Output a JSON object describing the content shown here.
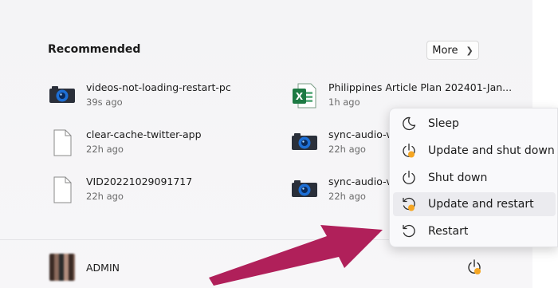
{
  "recommended": {
    "title": "Recommended",
    "more_label": "More",
    "items": [
      {
        "name": "videos-not-loading-restart-pc",
        "time": "39s ago",
        "icon": "camera-icon"
      },
      {
        "name": "clear-cache-twitter-app",
        "time": "22h ago",
        "icon": "document-icon"
      },
      {
        "name": "VID20221029091717",
        "time": "22h ago",
        "icon": "document-icon"
      },
      {
        "name": "Philippines Article Plan 202401-Jan...",
        "time": "1h ago",
        "icon": "excel-icon"
      },
      {
        "name": "sync-audio-vi",
        "time": "22h ago",
        "icon": "camera-icon"
      },
      {
        "name": "sync-audio-vi",
        "time": "22h ago",
        "icon": "camera-icon"
      }
    ]
  },
  "user": {
    "name": "ADMIN"
  },
  "power_menu": {
    "items": [
      {
        "label": "Sleep",
        "icon": "moon-icon"
      },
      {
        "label": "Update and shut down",
        "icon": "update-power-icon"
      },
      {
        "label": "Shut down",
        "icon": "power-icon"
      },
      {
        "label": "Update and restart",
        "icon": "update-restart-icon"
      },
      {
        "label": "Restart",
        "icon": "restart-icon"
      }
    ],
    "highlighted": "Update and restart"
  },
  "colors": {
    "accent": "#b0205a",
    "update_badge": "#f5a623",
    "excel_green": "#1d7a43"
  }
}
